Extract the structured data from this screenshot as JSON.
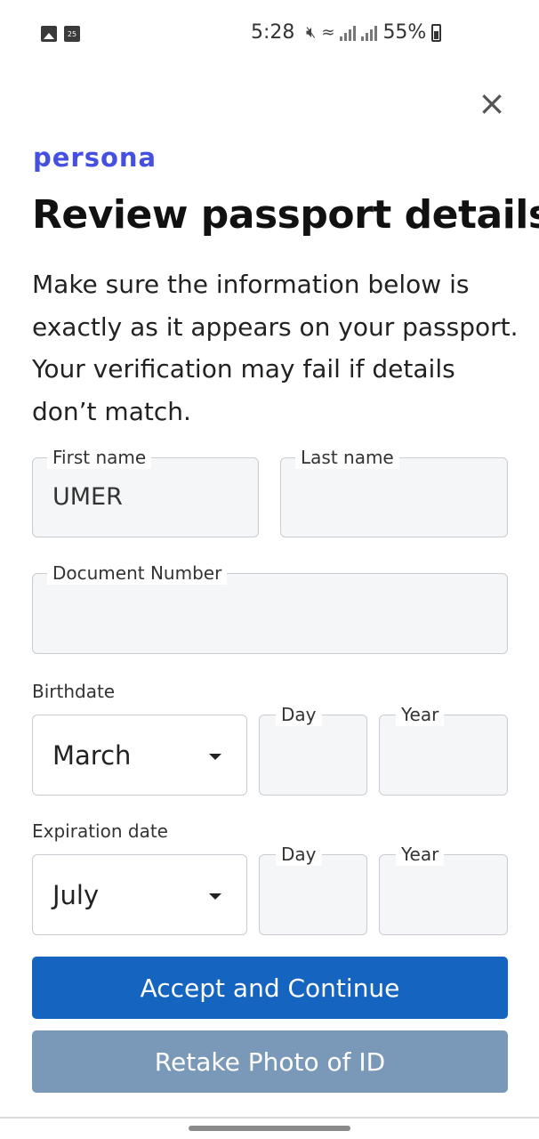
{
  "status_bar": {
    "time": "5:28",
    "battery": "55%",
    "icons": [
      "gallery-icon",
      "calendar-icon",
      "mute-icon",
      "wifi-icon",
      "signal-icon",
      "battery-icon"
    ],
    "calendar_day": "25"
  },
  "close_label": "×",
  "brand": "persona",
  "title": "Review passport details",
  "description": "Make sure the information below is exactly as it appears on your passport. Your verification may fail if details don’t match.",
  "fields": {
    "first_name": {
      "label": "First name",
      "value": "UMER"
    },
    "last_name": {
      "label": "Last name",
      "value": ""
    },
    "document_number": {
      "label": "Document Number",
      "value": ""
    }
  },
  "birthdate": {
    "label": "Birthdate",
    "month": "March",
    "day_label": "Day",
    "year_label": "Year"
  },
  "expiration": {
    "label": "Expiration date",
    "month": "July",
    "day_label": "Day",
    "year_label": "Year"
  },
  "buttons": {
    "accept": "Accept and Continue",
    "retake": "Retake Photo of ID"
  },
  "colors": {
    "brand": "#4650e0",
    "primary_button": "#1565c0",
    "secondary_button": "#7a99b8",
    "field_background": "#f5f6f8"
  }
}
